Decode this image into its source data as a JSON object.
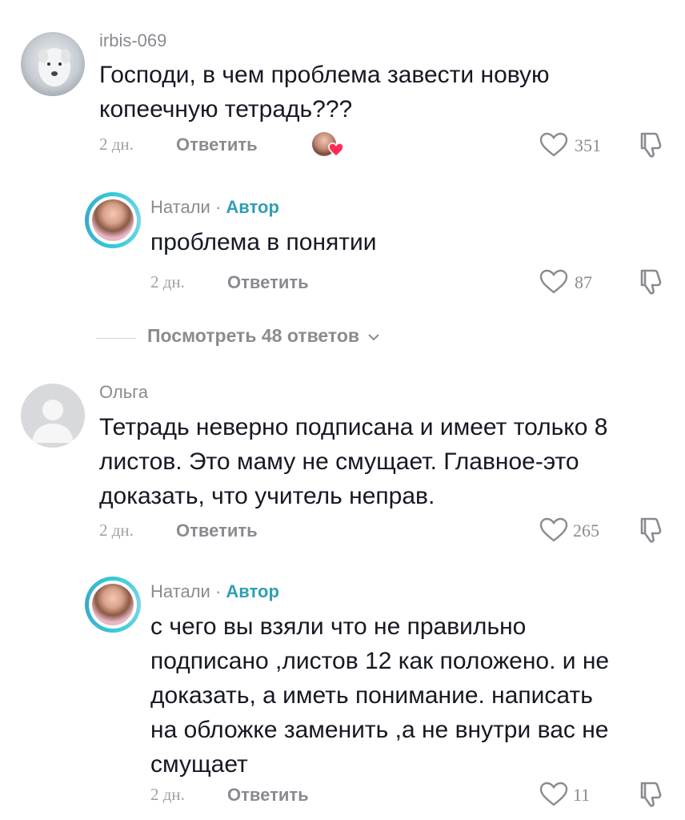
{
  "comments": [
    {
      "username": "irbis-069",
      "text_line1": "Господи, в чем проблема завести новую",
      "text_line2": "копеечную тетрадь???",
      "date": "2 дн.",
      "reply": "Ответить",
      "likes": "351"
    },
    {
      "username": "Натали",
      "author_sep": "·",
      "author_label": "Автор",
      "text_line1": "проблема в понятии",
      "date": "2 дн.",
      "reply": "Ответить",
      "likes": "87"
    },
    {
      "username": "Ольга",
      "text_line1": "Тетрадь неверно подписана и имеет только 8",
      "text_line2": "листов. Это маму не смущает. Главное-это",
      "text_line3": "доказать, что учитель неправ.",
      "date": "2 дн.",
      "reply": "Ответить",
      "likes": "265"
    },
    {
      "username": "Натали",
      "author_sep": "·",
      "author_label": "Автор",
      "text_line1": "с чего вы взяли что не правильно",
      "text_line2": "подписано ,листов 12 как положено. и не",
      "text_line3": "доказать, а иметь понимание. написать",
      "text_line4": "на обложке заменить ,а не внутри вас не",
      "text_line5": "смущает",
      "date": "2 дн.",
      "reply": "Ответить",
      "likes": "11"
    }
  ],
  "view_replies": "Посмотреть 48 ответов",
  "icons": {
    "like": "heart-outline-icon",
    "dislike": "thumbs-down-icon",
    "expand": "chevron-down-icon",
    "creator_liked": "creator-liked-heart-icon"
  },
  "colors": {
    "author": "#2f9fb3",
    "muted": "#8a8b91",
    "creator_heart": "#fe2c55"
  }
}
